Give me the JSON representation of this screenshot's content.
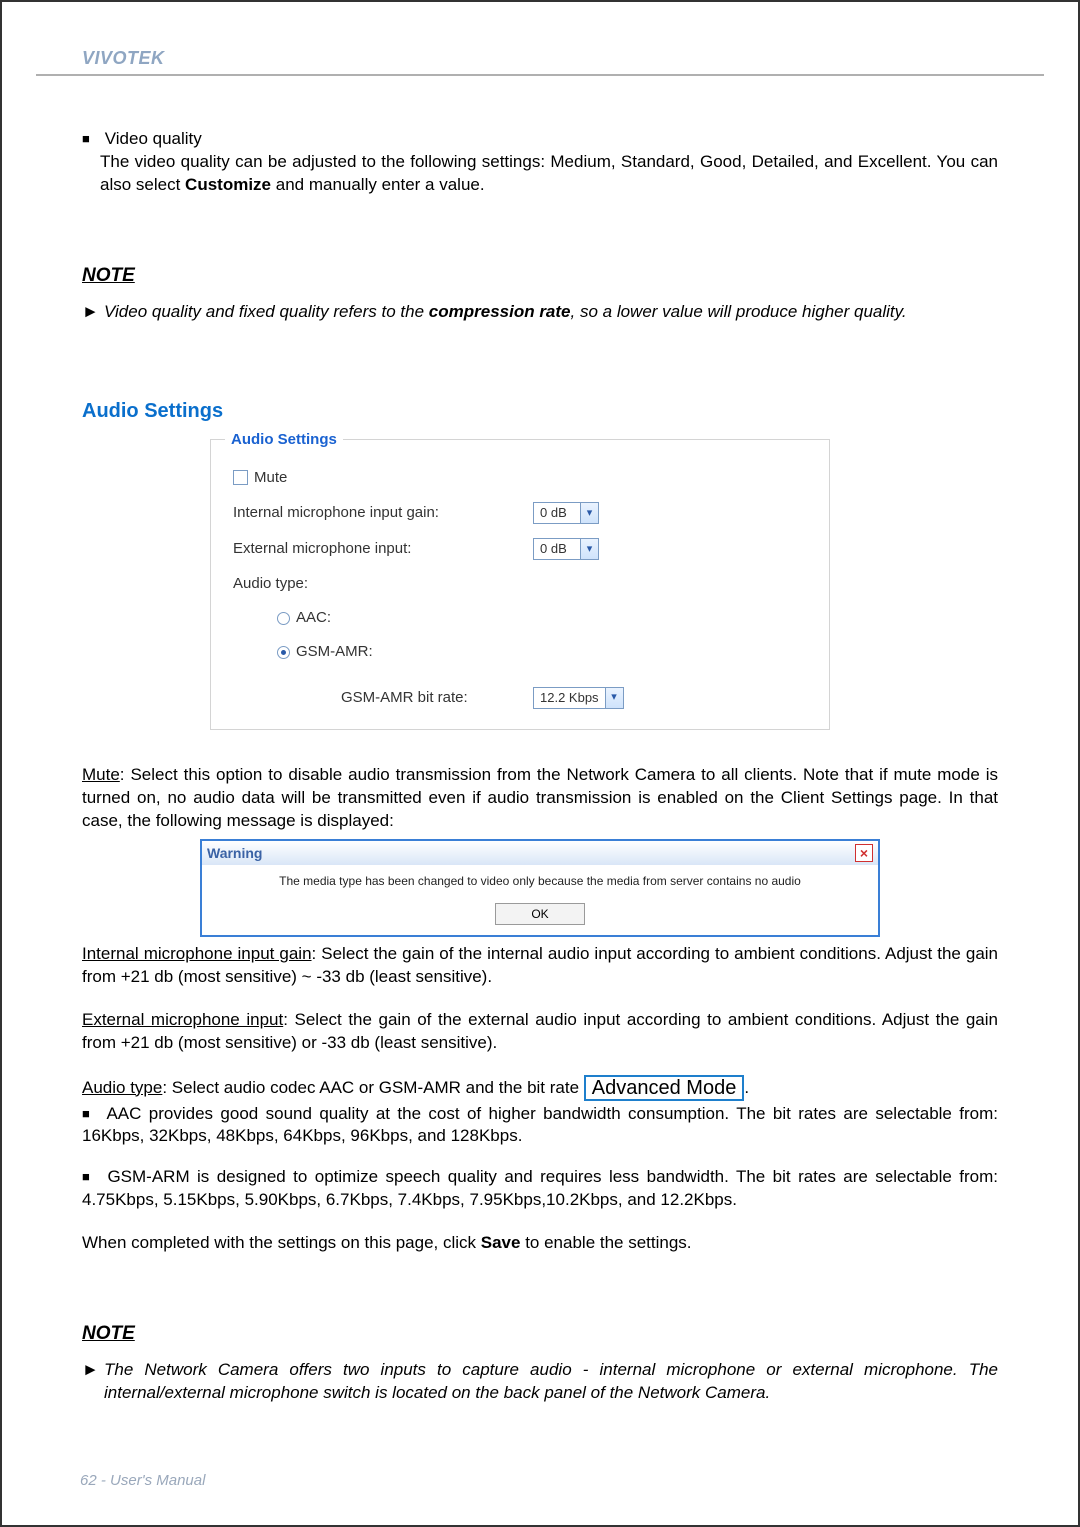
{
  "header": {
    "brand": "VIVOTEK"
  },
  "video_quality": {
    "title": "Video quality",
    "body_1": "The video quality can be adjusted to the following settings: Medium, Standard, Good, Detailed, and Excellent. You can also select ",
    "body_bold": "Customize",
    "body_2": " and manually enter a value."
  },
  "note1": {
    "heading": "NOTE",
    "text_1": "Video quality and fixed quality refers to the ",
    "text_bold": "compression rate",
    "text_2": ", so a lower value will produce higher quality."
  },
  "audio_section": {
    "heading": "Audio Settings"
  },
  "audio_fig": {
    "box_title": "Audio Settings",
    "mute_label": "Mute",
    "mute_checked": false,
    "internal_gain_label": "Internal microphone input gain:",
    "internal_gain_value": "0 dB",
    "external_input_label": "External microphone input:",
    "external_input_value": "0 dB",
    "audio_type_label": "Audio type:",
    "aac_label": "AAC:",
    "aac_checked": false,
    "gsm_label": "GSM-AMR:",
    "gsm_checked": true,
    "bitrate_label": "GSM-AMR bit rate:",
    "bitrate_value": "12.2 Kbps"
  },
  "mute_para": {
    "lead": "Mute",
    "body": ": Select this option to disable audio transmission from the Network Camera to all clients. Note that if mute mode is turned on, no audio data will be transmitted even if audio transmission is enabled on the Client Settings page. In that case, the following message is displayed:"
  },
  "warn_fig": {
    "title": "Warning",
    "message": "The media type has been changed to video only because the media from server contains no audio",
    "ok": "OK"
  },
  "internal_para": {
    "lead": "Internal microphone input gain",
    "body": ": Select the gain of the internal audio input according to ambient conditions. Adjust the gain from +21 db (most sensitive) ~ -33 db (least sensitive)."
  },
  "external_para": {
    "lead": "External microphone input",
    "body": ": Select the gain of the external audio input according to ambient conditions. Adjust the gain from +21 db (most sensitive) or -33 db (least sensitive)."
  },
  "audiotype_para": {
    "lead": "Audio type",
    "body": ": Select audio codec AAC or GSM-AMR and the bit rate ",
    "badge": "Advanced Mode",
    "tail": "."
  },
  "aac_para": "AAC provides good sound quality at the cost of higher bandwidth consumption. The bit rates are selectable from: 16Kbps, 32Kbps, 48Kbps, 64Kbps, 96Kbps, and 128Kbps.",
  "gsm_para": "GSM-ARM is designed to optimize speech quality and requires less bandwidth. The bit rates are selectable from: 4.75Kbps, 5.15Kbps, 5.90Kbps, 6.7Kbps, 7.4Kbps, 7.95Kbps,10.2Kbps, and 12.2Kbps.",
  "save_para": {
    "pre": "When completed with the settings on this page, click ",
    "bold": "Save",
    "post": " to enable the settings."
  },
  "note2": {
    "heading": "NOTE",
    "text": "The Network Camera offers two inputs to capture audio - internal microphone or external microphone. The internal/external microphone switch is located on the back panel of the Network Camera."
  },
  "footer": {
    "page": "62",
    "label": "User's Manual"
  }
}
